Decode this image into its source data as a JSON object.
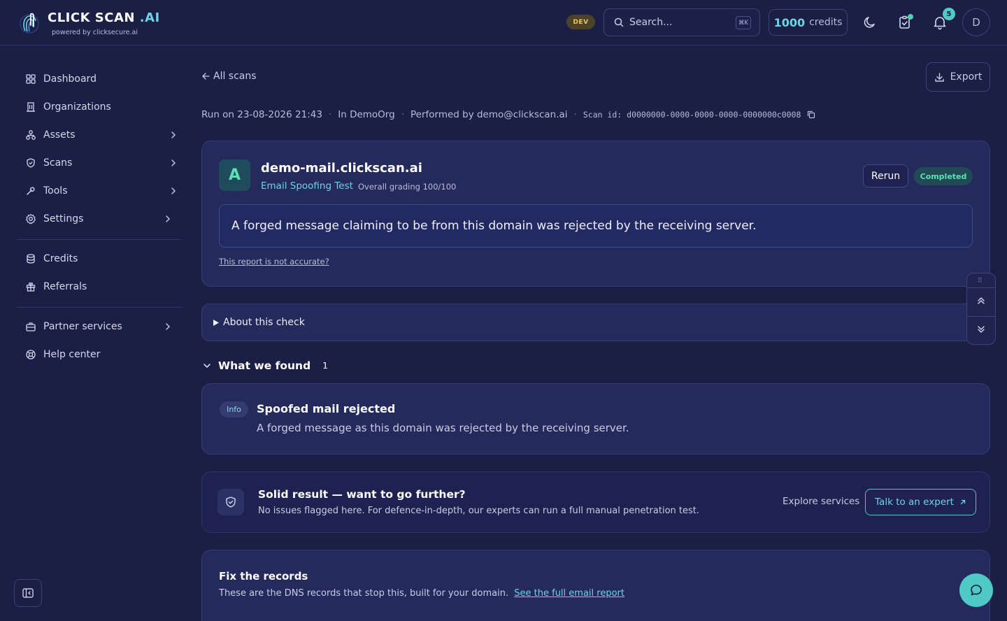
{
  "brand": {
    "name": "CLICK SCAN",
    "suffix": ".AI",
    "tagline": "powered by clicksecure.ai"
  },
  "header": {
    "env_badge": "DEV",
    "search_placeholder": "Search...",
    "search_shortcut": "⌘K",
    "credits_amount": "1000",
    "credits_label": "credits",
    "notifications_count": "5",
    "avatar_initial": "D"
  },
  "sidebar": {
    "items": [
      {
        "label": "Dashboard",
        "icon": "grid-icon"
      },
      {
        "label": "Organizations",
        "icon": "building-icon"
      },
      {
        "label": "Assets",
        "icon": "assets-icon",
        "expandable": true
      },
      {
        "label": "Scans",
        "icon": "shield-icon",
        "expandable": true
      },
      {
        "label": "Tools",
        "icon": "hammer-icon",
        "expandable": true
      },
      {
        "label": "Settings",
        "icon": "gear-icon",
        "expandable": true
      },
      {
        "label": "Credits",
        "icon": "database-icon"
      },
      {
        "label": "Referrals",
        "icon": "gift-icon"
      },
      {
        "label": "Partner services",
        "icon": "briefcase-icon",
        "expandable": true
      },
      {
        "label": "Help center",
        "icon": "lifebuoy-icon"
      }
    ]
  },
  "page": {
    "back_label": "All scans",
    "export_label": "Export",
    "meta": {
      "run_on": "Run on 23-08-2026 21:43",
      "org": "In DemoOrg",
      "performed_by": "Performed by demo@clickscan.ai",
      "scan_id": "Scan id: d0000000-0000-0000-0000-0000000c0008"
    }
  },
  "result": {
    "grade": "A",
    "domain": "demo-mail.clickscan.ai",
    "test_name": "Email Spoofing Test",
    "grading": "Overall grading 100/100",
    "rerun_label": "Rerun",
    "status": "Completed",
    "summary": "A forged message claiming to be from this domain was rejected by the receiving server.",
    "feedback_link": "This report is not accurate?"
  },
  "about": {
    "label": "About this check"
  },
  "findings": {
    "title": "What we found",
    "count": "1",
    "items": [
      {
        "severity": "Info",
        "title": "Spoofed mail rejected",
        "description": "A forged message as this domain was rejected by the receiving server."
      }
    ]
  },
  "promo": {
    "title": "Solid result — want to go further?",
    "description": "No issues flagged here. For defence-in-depth, our experts can run a full manual penetration test.",
    "explore_label": "Explore services",
    "cta_label": "Talk to an expert"
  },
  "fix": {
    "title": "Fix the records",
    "description": "These are the DNS records that stop this, built for your domain.",
    "link_label": "See the full email report"
  },
  "colors": {
    "background": "#1b1f45",
    "card": "#252a5c",
    "accent": "#6fd3e6",
    "success": "#5fe0b4",
    "warning": "#f0c36a"
  }
}
